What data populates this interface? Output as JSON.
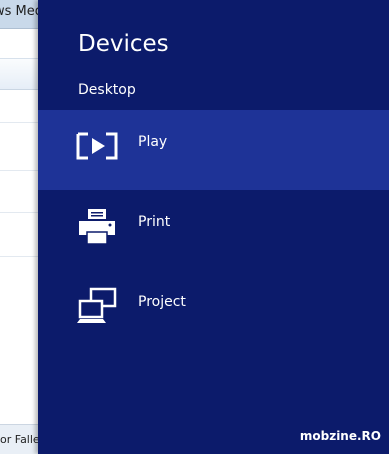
{
  "background_window": {
    "title_fragment": "ws Med",
    "status_fragment": "or Faller"
  },
  "charm": {
    "title": "Devices",
    "section": "Desktop",
    "items": [
      {
        "label": "Play",
        "icon": "play-to-icon",
        "selected": true
      },
      {
        "label": "Print",
        "icon": "printer-icon",
        "selected": false
      },
      {
        "label": "Project",
        "icon": "project-icon",
        "selected": false
      }
    ]
  },
  "watermark": "mobzine.RO",
  "colors": {
    "pane_background": "#0c1b6b",
    "selected_item": "#1e3397",
    "text": "#ffffff"
  }
}
